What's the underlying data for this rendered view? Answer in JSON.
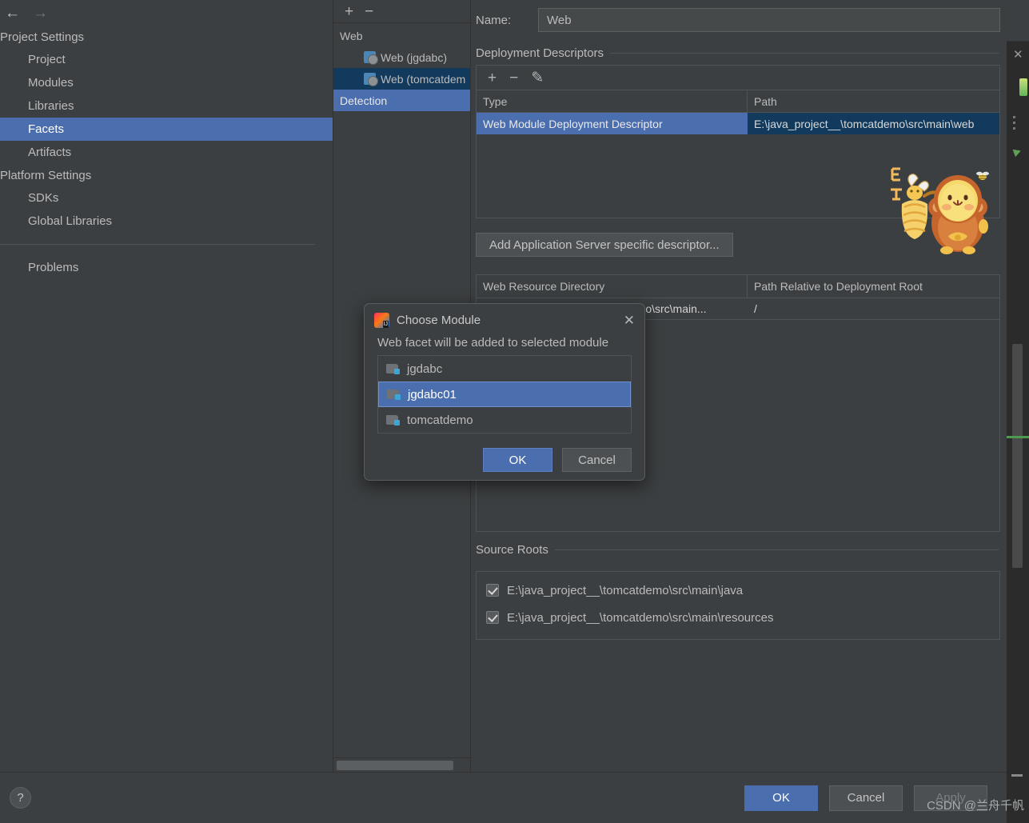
{
  "nav": {
    "back_icon": "arrow-left-icon",
    "forward_icon": "arrow-right-icon",
    "groups": [
      {
        "label": "Project Settings",
        "items": [
          {
            "label": "Project",
            "selected": false
          },
          {
            "label": "Modules",
            "selected": false
          },
          {
            "label": "Libraries",
            "selected": false
          },
          {
            "label": "Facets",
            "selected": true
          },
          {
            "label": "Artifacts",
            "selected": false
          }
        ]
      },
      {
        "label": "Platform Settings",
        "items": [
          {
            "label": "SDKs",
            "selected": false
          },
          {
            "label": "Global Libraries",
            "selected": false
          }
        ]
      }
    ],
    "problems_label": "Problems"
  },
  "facet_tree": {
    "toolbar": {
      "add_label": "+",
      "remove_label": "−"
    },
    "root_label": "Web",
    "nodes": [
      {
        "label": "Web (jgdabc)",
        "state": "normal"
      },
      {
        "label": "Web (tomcatdem",
        "state": "selected-inactive"
      }
    ],
    "detection_label": "Detection"
  },
  "facet_editor": {
    "name_label": "Name:",
    "name_value": "Web",
    "deployment_descriptors": {
      "title": "Deployment Descriptors",
      "toolbar": {
        "add": "+",
        "remove": "−",
        "edit": "✎"
      },
      "columns": [
        "Type",
        "Path"
      ],
      "rows": [
        {
          "type": "Web Module Deployment Descriptor",
          "path": "E:\\java_project__\\tomcatdemo\\src\\main\\web"
        }
      ]
    },
    "add_server_descriptor_label": "Add Application Server specific descriptor...",
    "web_resources": {
      "columns": [
        "Web Resource Directory",
        "Path Relative to Deployment Root"
      ],
      "rows": [
        {
          "directory": "E:\\java_project__\\tomcatdemo\\src\\main...",
          "relative_path": "/"
        }
      ]
    },
    "source_roots": {
      "title": "Source Roots",
      "items": [
        {
          "label": "E:\\java_project__\\tomcatdemo\\src\\main\\java",
          "checked": true
        },
        {
          "label": "E:\\java_project__\\tomcatdemo\\src\\main\\resources",
          "checked": true
        }
      ]
    }
  },
  "choose_module_dialog": {
    "title": "Choose Module",
    "app_icon": "intellij-idea-icon",
    "close_icon": "close-icon",
    "subtitle": "Web facet will be added to selected module",
    "modules": [
      {
        "label": "jgdabc",
        "selected": false
      },
      {
        "label": "jgdabc01",
        "selected": true
      },
      {
        "label": "tomcatdemo",
        "selected": false
      }
    ],
    "ok_label": "OK",
    "cancel_label": "Cancel"
  },
  "footer": {
    "help_label": "?",
    "ok_label": "OK",
    "cancel_label": "Cancel",
    "apply_label": "Apply",
    "apply_enabled": false
  },
  "watermark": "CSDN @兰舟千帆",
  "colors": {
    "panel_bg": "#3c3f41",
    "selection_blue": "#4b6eaf",
    "selection_inactive": "#113a5c",
    "text": "#bbbbbb",
    "border": "#4f5356",
    "editor_bg": "#2b2b2b"
  }
}
